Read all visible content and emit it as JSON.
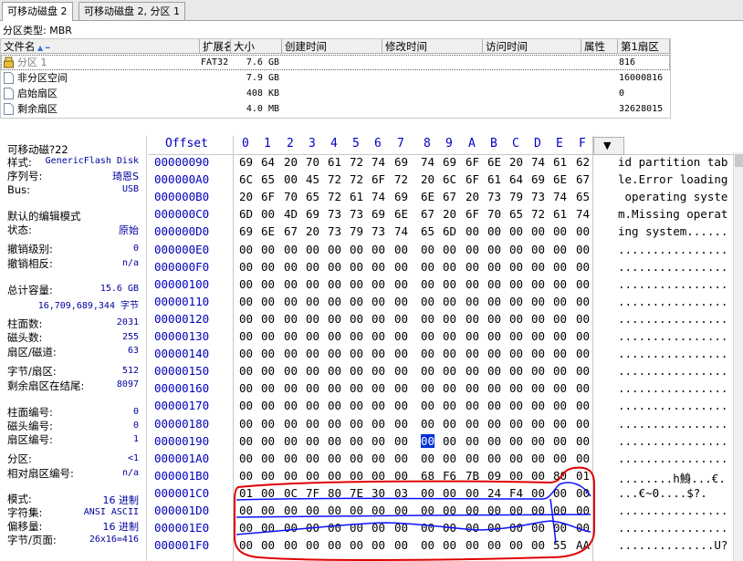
{
  "tabs": [
    {
      "label": "可移动磁盘 2",
      "active": true
    },
    {
      "label": "可移动磁盘 2, 分区 1",
      "active": false
    }
  ],
  "partition_type": "分区类型: MBR",
  "file_table": {
    "columns": [
      "文件名",
      "扩展名",
      "大小",
      "创建时间",
      "修改时间",
      "访问时间",
      "属性",
      "第1扇区"
    ],
    "rows": [
      {
        "name": "分区 1",
        "ext": "FAT32",
        "size": "7.6 GB",
        "first_sector": "816",
        "selected": true
      },
      {
        "name": "非分区空间",
        "ext": "",
        "size": "7.9 GB",
        "first_sector": "16000816"
      },
      {
        "name": "启始扇区",
        "ext": "",
        "size": "408 KB",
        "first_sector": "0"
      },
      {
        "name": "剩余扇区",
        "ext": "",
        "size": "4.0 MB",
        "first_sector": "32628015"
      }
    ]
  },
  "info_panel": {
    "title": "可移动磁?22",
    "items": [
      {
        "label": "样式:",
        "value": "GenericFlash Disk"
      },
      {
        "label": "序列号:",
        "value": "琦恩S"
      },
      {
        "label": "Bus:",
        "value": "USB"
      },
      {
        "label": "默认的编辑模式",
        "value": ""
      },
      {
        "label": "状态:",
        "value": "原始"
      },
      {
        "label": "撤销级别:",
        "value": "0"
      },
      {
        "label": "撤销相反:",
        "value": "n/a"
      },
      {
        "label": "总计容量:",
        "value": "15.6 GB"
      },
      {
        "label": "",
        "value": "16,709,689,344 字节"
      },
      {
        "label": "柱面数:",
        "value": "2031"
      },
      {
        "label": "磁头数:",
        "value": "255"
      },
      {
        "label": "扇区/磁道:",
        "value": "63"
      },
      {
        "label": "字节/扇区:",
        "value": "512"
      },
      {
        "label": "剩余扇区在结尾:",
        "value": "8097"
      },
      {
        "label": "柱面编号:",
        "value": "0"
      },
      {
        "label": "磁头编号:",
        "value": "0"
      },
      {
        "label": "扇区编号:",
        "value": "1"
      },
      {
        "label": "分区:",
        "value": "<1"
      },
      {
        "label": "相对扇区编号:",
        "value": "n/a"
      },
      {
        "label": "模式:",
        "value": "16 进制"
      },
      {
        "label": "字符集:",
        "value": "ANSI ASCII"
      },
      {
        "label": "偏移量:",
        "value": "16 进制"
      },
      {
        "label": "字节/页面:",
        "value": "26x16=416"
      }
    ]
  },
  "hex_editor": {
    "offset_header": "Offset",
    "column_headers": [
      "0",
      "1",
      "2",
      "3",
      "4",
      "5",
      "6",
      "7",
      "8",
      "9",
      "A",
      "B",
      "C",
      "D",
      "E",
      "F"
    ],
    "cursor": {
      "offset": "00000190",
      "column": "8"
    },
    "lines": [
      {
        "offset": "00000090",
        "bytes": [
          "69",
          "64",
          "20",
          "70",
          "61",
          "72",
          "74",
          "69",
          "74",
          "69",
          "6F",
          "6E",
          "20",
          "74",
          "61",
          "62"
        ],
        "ascii": "id partition tab"
      },
      {
        "offset": "000000A0",
        "bytes": [
          "6C",
          "65",
          "00",
          "45",
          "72",
          "72",
          "6F",
          "72",
          "20",
          "6C",
          "6F",
          "61",
          "64",
          "69",
          "6E",
          "67"
        ],
        "ascii": "le.Error loading"
      },
      {
        "offset": "000000B0",
        "bytes": [
          "20",
          "6F",
          "70",
          "65",
          "72",
          "61",
          "74",
          "69",
          "6E",
          "67",
          "20",
          "73",
          "79",
          "73",
          "74",
          "65"
        ],
        "ascii": " operating syste"
      },
      {
        "offset": "000000C0",
        "bytes": [
          "6D",
          "00",
          "4D",
          "69",
          "73",
          "73",
          "69",
          "6E",
          "67",
          "20",
          "6F",
          "70",
          "65",
          "72",
          "61",
          "74"
        ],
        "ascii": "m.Missing operat"
      },
      {
        "offset": "000000D0",
        "bytes": [
          "69",
          "6E",
          "67",
          "20",
          "73",
          "79",
          "73",
          "74",
          "65",
          "6D",
          "00",
          "00",
          "00",
          "00",
          "00",
          "00"
        ],
        "ascii": "ing system......"
      },
      {
        "offset": "000000E0",
        "bytes": [
          "00",
          "00",
          "00",
          "00",
          "00",
          "00",
          "00",
          "00",
          "00",
          "00",
          "00",
          "00",
          "00",
          "00",
          "00",
          "00"
        ],
        "ascii": "................"
      },
      {
        "offset": "000000F0",
        "bytes": [
          "00",
          "00",
          "00",
          "00",
          "00",
          "00",
          "00",
          "00",
          "00",
          "00",
          "00",
          "00",
          "00",
          "00",
          "00",
          "00"
        ],
        "ascii": "................"
      },
      {
        "offset": "00000100",
        "bytes": [
          "00",
          "00",
          "00",
          "00",
          "00",
          "00",
          "00",
          "00",
          "00",
          "00",
          "00",
          "00",
          "00",
          "00",
          "00",
          "00"
        ],
        "ascii": "................"
      },
      {
        "offset": "00000110",
        "bytes": [
          "00",
          "00",
          "00",
          "00",
          "00",
          "00",
          "00",
          "00",
          "00",
          "00",
          "00",
          "00",
          "00",
          "00",
          "00",
          "00"
        ],
        "ascii": "................"
      },
      {
        "offset": "00000120",
        "bytes": [
          "00",
          "00",
          "00",
          "00",
          "00",
          "00",
          "00",
          "00",
          "00",
          "00",
          "00",
          "00",
          "00",
          "00",
          "00",
          "00"
        ],
        "ascii": "................"
      },
      {
        "offset": "00000130",
        "bytes": [
          "00",
          "00",
          "00",
          "00",
          "00",
          "00",
          "00",
          "00",
          "00",
          "00",
          "00",
          "00",
          "00",
          "00",
          "00",
          "00"
        ],
        "ascii": "................"
      },
      {
        "offset": "00000140",
        "bytes": [
          "00",
          "00",
          "00",
          "00",
          "00",
          "00",
          "00",
          "00",
          "00",
          "00",
          "00",
          "00",
          "00",
          "00",
          "00",
          "00"
        ],
        "ascii": "................"
      },
      {
        "offset": "00000150",
        "bytes": [
          "00",
          "00",
          "00",
          "00",
          "00",
          "00",
          "00",
          "00",
          "00",
          "00",
          "00",
          "00",
          "00",
          "00",
          "00",
          "00"
        ],
        "ascii": "................"
      },
      {
        "offset": "00000160",
        "bytes": [
          "00",
          "00",
          "00",
          "00",
          "00",
          "00",
          "00",
          "00",
          "00",
          "00",
          "00",
          "00",
          "00",
          "00",
          "00",
          "00"
        ],
        "ascii": "................"
      },
      {
        "offset": "00000170",
        "bytes": [
          "00",
          "00",
          "00",
          "00",
          "00",
          "00",
          "00",
          "00",
          "00",
          "00",
          "00",
          "00",
          "00",
          "00",
          "00",
          "00"
        ],
        "ascii": "................"
      },
      {
        "offset": "00000180",
        "bytes": [
          "00",
          "00",
          "00",
          "00",
          "00",
          "00",
          "00",
          "00",
          "00",
          "00",
          "00",
          "00",
          "00",
          "00",
          "00",
          "00"
        ],
        "ascii": "................"
      },
      {
        "offset": "00000190",
        "bytes": [
          "00",
          "00",
          "00",
          "00",
          "00",
          "00",
          "00",
          "00",
          "00",
          "00",
          "00",
          "00",
          "00",
          "00",
          "00",
          "00"
        ],
        "ascii": "................"
      },
      {
        "offset": "000001A0",
        "bytes": [
          "00",
          "00",
          "00",
          "00",
          "00",
          "00",
          "00",
          "00",
          "00",
          "00",
          "00",
          "00",
          "00",
          "00",
          "00",
          "00"
        ],
        "ascii": "................"
      },
      {
        "offset": "000001B0",
        "bytes": [
          "00",
          "00",
          "00",
          "00",
          "00",
          "00",
          "00",
          "00",
          "68",
          "F6",
          "7B",
          "09",
          "00",
          "00",
          "80",
          "01"
        ],
        "ascii": "........h鯓...€."
      },
      {
        "offset": "000001C0",
        "bytes": [
          "01",
          "00",
          "0C",
          "7F",
          "80",
          "7E",
          "30",
          "03",
          "00",
          "00",
          "00",
          "24",
          "F4",
          "00",
          "00",
          "00"
        ],
        "ascii": "...€~0....$?."
      },
      {
        "offset": "000001D0",
        "bytes": [
          "00",
          "00",
          "00",
          "00",
          "00",
          "00",
          "00",
          "00",
          "00",
          "00",
          "00",
          "00",
          "00",
          "00",
          "00",
          "00"
        ],
        "ascii": "................"
      },
      {
        "offset": "000001E0",
        "bytes": [
          "00",
          "00",
          "00",
          "00",
          "00",
          "00",
          "00",
          "00",
          "00",
          "00",
          "00",
          "00",
          "00",
          "00",
          "00",
          "00"
        ],
        "ascii": "................"
      },
      {
        "offset": "000001F0",
        "bytes": [
          "00",
          "00",
          "00",
          "00",
          "00",
          "00",
          "00",
          "00",
          "00",
          "00",
          "00",
          "00",
          "00",
          "00",
          "55",
          "AA"
        ],
        "ascii": "..............U?"
      }
    ]
  },
  "colors": {
    "offset_blue": "#0000c0",
    "annotation_red": "#e00000",
    "annotation_blue": "#1010ff"
  }
}
